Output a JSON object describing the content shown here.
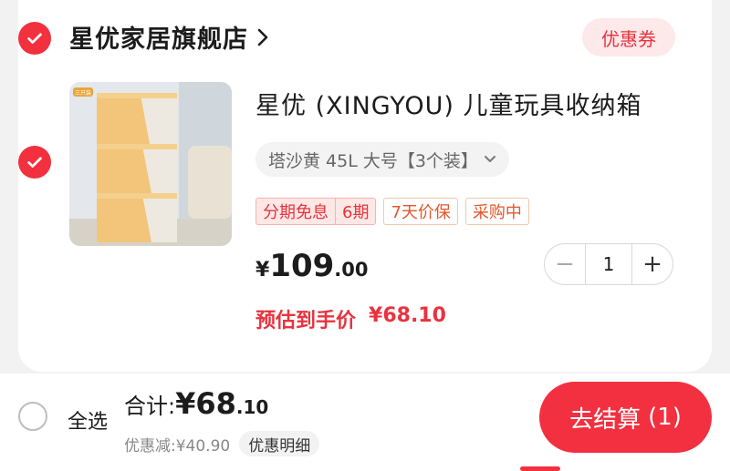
{
  "colors": {
    "accent": "#f2303e",
    "price_red": "#e8333e",
    "tag_orange": "#e2572c",
    "background": "#f2f2f2",
    "card": "#ffffff"
  },
  "shop": {
    "name": "星优家居旗舰店",
    "selected": true,
    "chevron_icon": "chevron-right-icon",
    "coupon_label": "优惠券"
  },
  "item": {
    "selected": true,
    "image_icon": "product-image",
    "image_badge": "三只装",
    "title": "星优 (XINGYOU) 儿童玩具收纳箱",
    "sku": "塔沙黄 45L 大号【3个装】",
    "tags": [
      "分期免息",
      "6期",
      "7天价保",
      "采购中"
    ],
    "price": {
      "currency": "¥",
      "integer": "109",
      "decimal": ".00"
    },
    "quantity": "1",
    "minus_label": "−",
    "plus_label": "+",
    "estimate_label": "预估到手价",
    "estimate_price": "¥68.10"
  },
  "footer": {
    "select_all": "全选",
    "total_label": "合计:",
    "total_amount": "¥68",
    "total_decimal": ".10",
    "discount": "优惠减:¥40.90",
    "discount_detail": "优惠明细",
    "checkout": "去结算",
    "checkout_count": "(1)"
  }
}
